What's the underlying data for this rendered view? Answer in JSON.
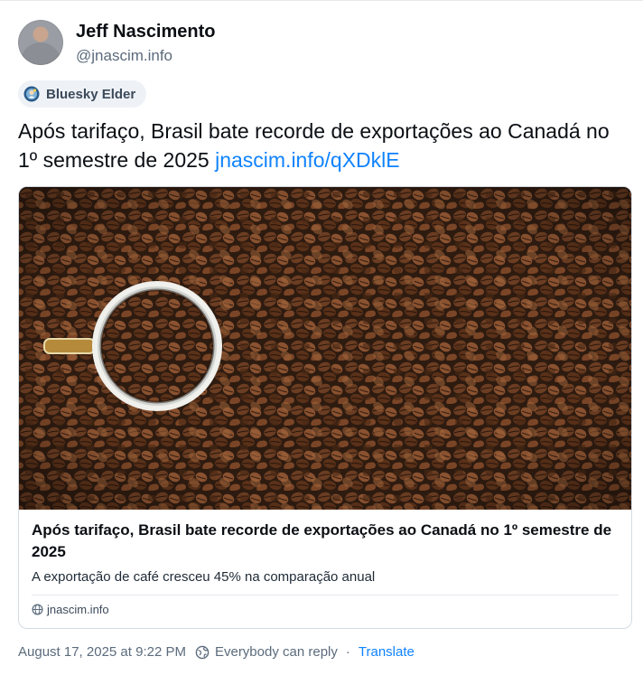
{
  "author": {
    "name": "Jeff Nascimento",
    "handle": "@jnascim.info"
  },
  "badge": {
    "label": "Bluesky Elder"
  },
  "post": {
    "text": "Após tarifaço, Brasil bate recorde de exportações ao Canadá no 1º semestre de 2025 ",
    "link_text": "jnascim.info/qXDklE"
  },
  "card": {
    "title": "Após tarifaço, Brasil bate recorde de exportações ao Canadá no 1º semestre de 2025",
    "description": "A exportação de café cresceu 45% na comparação anual",
    "domain": "jnascim.info"
  },
  "meta": {
    "timestamp": "August 17, 2025 at 9:22 PM",
    "reply_setting": "Everybody can reply",
    "separator": "·",
    "translate": "Translate"
  },
  "colors": {
    "link": "#1083fe",
    "muted": "#5b6b7c"
  }
}
